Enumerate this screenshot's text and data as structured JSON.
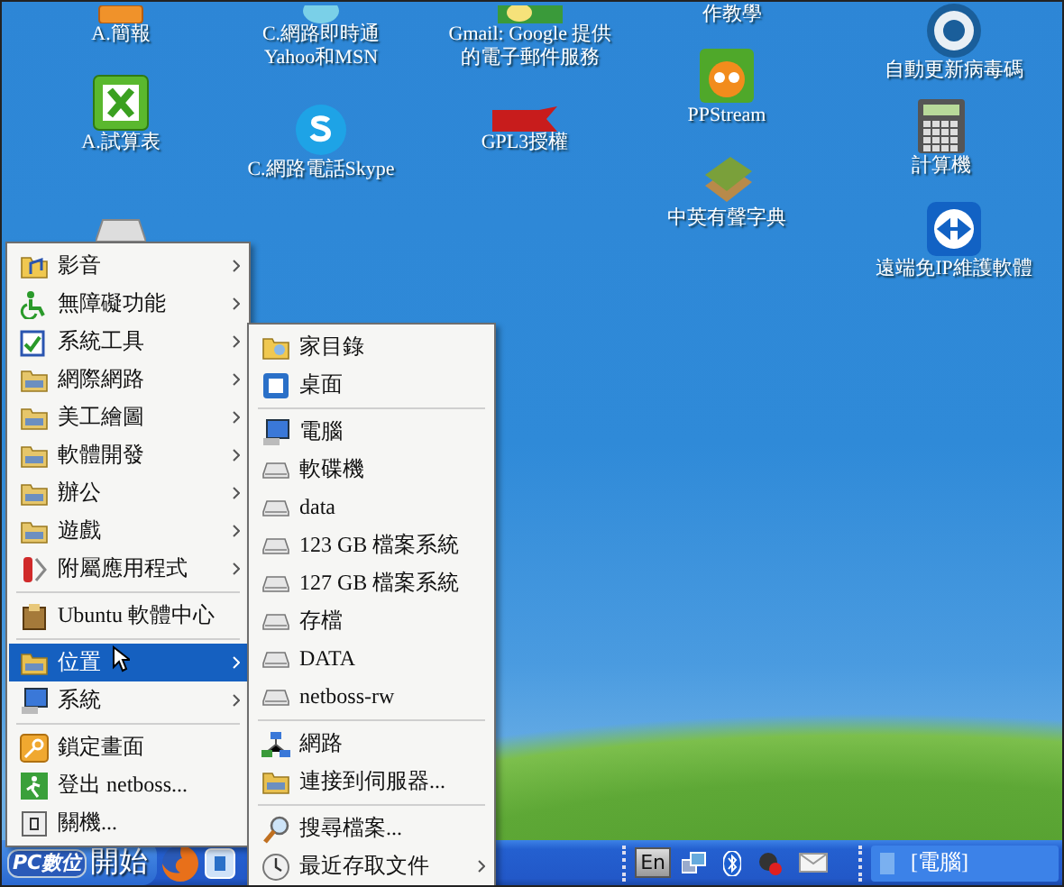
{
  "desktop": {
    "icons": [
      {
        "lines": [
          "A.簡報"
        ]
      },
      {
        "lines": [
          "C.網路即時通",
          "Yahoo和MSN"
        ]
      },
      {
        "lines": [
          "Gmail: Google 提供",
          "的電子郵件服務"
        ]
      },
      {
        "lines": [
          "作教學"
        ]
      },
      {
        "lines": [
          "自動更新病毒碼"
        ]
      },
      {
        "lines": [
          "A.試算表"
        ]
      },
      {
        "lines": [
          "C.網路電話Skype"
        ]
      },
      {
        "lines": [
          "GPL3授權"
        ]
      },
      {
        "lines": [
          "PPStream"
        ]
      },
      {
        "lines": [
          "計算機"
        ]
      },
      {
        "lines": [
          "中英有聲字典"
        ]
      },
      {
        "lines": [
          "遠端免IP維護軟體"
        ]
      }
    ]
  },
  "menu": {
    "groups": [
      {
        "items": [
          {
            "label": "影音",
            "has_submenu": true,
            "selected": false
          },
          {
            "label": "無障礙功能",
            "has_submenu": true,
            "selected": false
          },
          {
            "label": "系統工具",
            "has_submenu": true,
            "selected": false
          },
          {
            "label": "網際網路",
            "has_submenu": true,
            "selected": false
          },
          {
            "label": "美工繪圖",
            "has_submenu": true,
            "selected": false
          },
          {
            "label": "軟體開發",
            "has_submenu": true,
            "selected": false
          },
          {
            "label": "辦公",
            "has_submenu": true,
            "selected": false
          },
          {
            "label": "遊戲",
            "has_submenu": true,
            "selected": false
          },
          {
            "label": "附屬應用程式",
            "has_submenu": true,
            "selected": false
          }
        ]
      },
      {
        "items": [
          {
            "label": "Ubuntu 軟體中心",
            "has_submenu": false,
            "selected": false
          }
        ]
      },
      {
        "items": [
          {
            "label": "位置",
            "has_submenu": true,
            "selected": true
          },
          {
            "label": "系統",
            "has_submenu": true,
            "selected": false
          }
        ]
      },
      {
        "items": [
          {
            "label": "鎖定畫面",
            "has_submenu": false,
            "selected": false
          },
          {
            "label": "登出 netboss...",
            "has_submenu": false,
            "selected": false
          },
          {
            "label": "關機...",
            "has_submenu": false,
            "selected": false
          }
        ]
      }
    ]
  },
  "submenu": {
    "groups": [
      {
        "items": [
          {
            "label": "家目錄",
            "has_submenu": false,
            "selected": false
          },
          {
            "label": "桌面",
            "has_submenu": false,
            "selected": false
          }
        ]
      },
      {
        "items": [
          {
            "label": "電腦",
            "has_submenu": false,
            "selected": false
          },
          {
            "label": "軟碟機",
            "has_submenu": false,
            "selected": false
          },
          {
            "label": "data",
            "has_submenu": false,
            "selected": false
          },
          {
            "label": "123 GB 檔案系統",
            "has_submenu": false,
            "selected": false
          },
          {
            "label": "127 GB 檔案系統",
            "has_submenu": false,
            "selected": false
          },
          {
            "label": "存檔",
            "has_submenu": false,
            "selected": false
          },
          {
            "label": "DATA",
            "has_submenu": false,
            "selected": false
          },
          {
            "label": "netboss-rw",
            "has_submenu": false,
            "selected": false
          }
        ]
      },
      {
        "items": [
          {
            "label": "網路",
            "has_submenu": false,
            "selected": false
          },
          {
            "label": "連接到伺服器...",
            "has_submenu": false,
            "selected": false
          }
        ]
      },
      {
        "items": [
          {
            "label": "搜尋檔案...",
            "has_submenu": false,
            "selected": false
          },
          {
            "label": "最近存取文件",
            "has_submenu": true,
            "selected": false
          }
        ]
      }
    ]
  },
  "taskbar": {
    "logo": "PC數位",
    "start_label": "開始",
    "language": "En",
    "tasks": [
      {
        "label": "[電腦]",
        "selected": false
      }
    ]
  }
}
